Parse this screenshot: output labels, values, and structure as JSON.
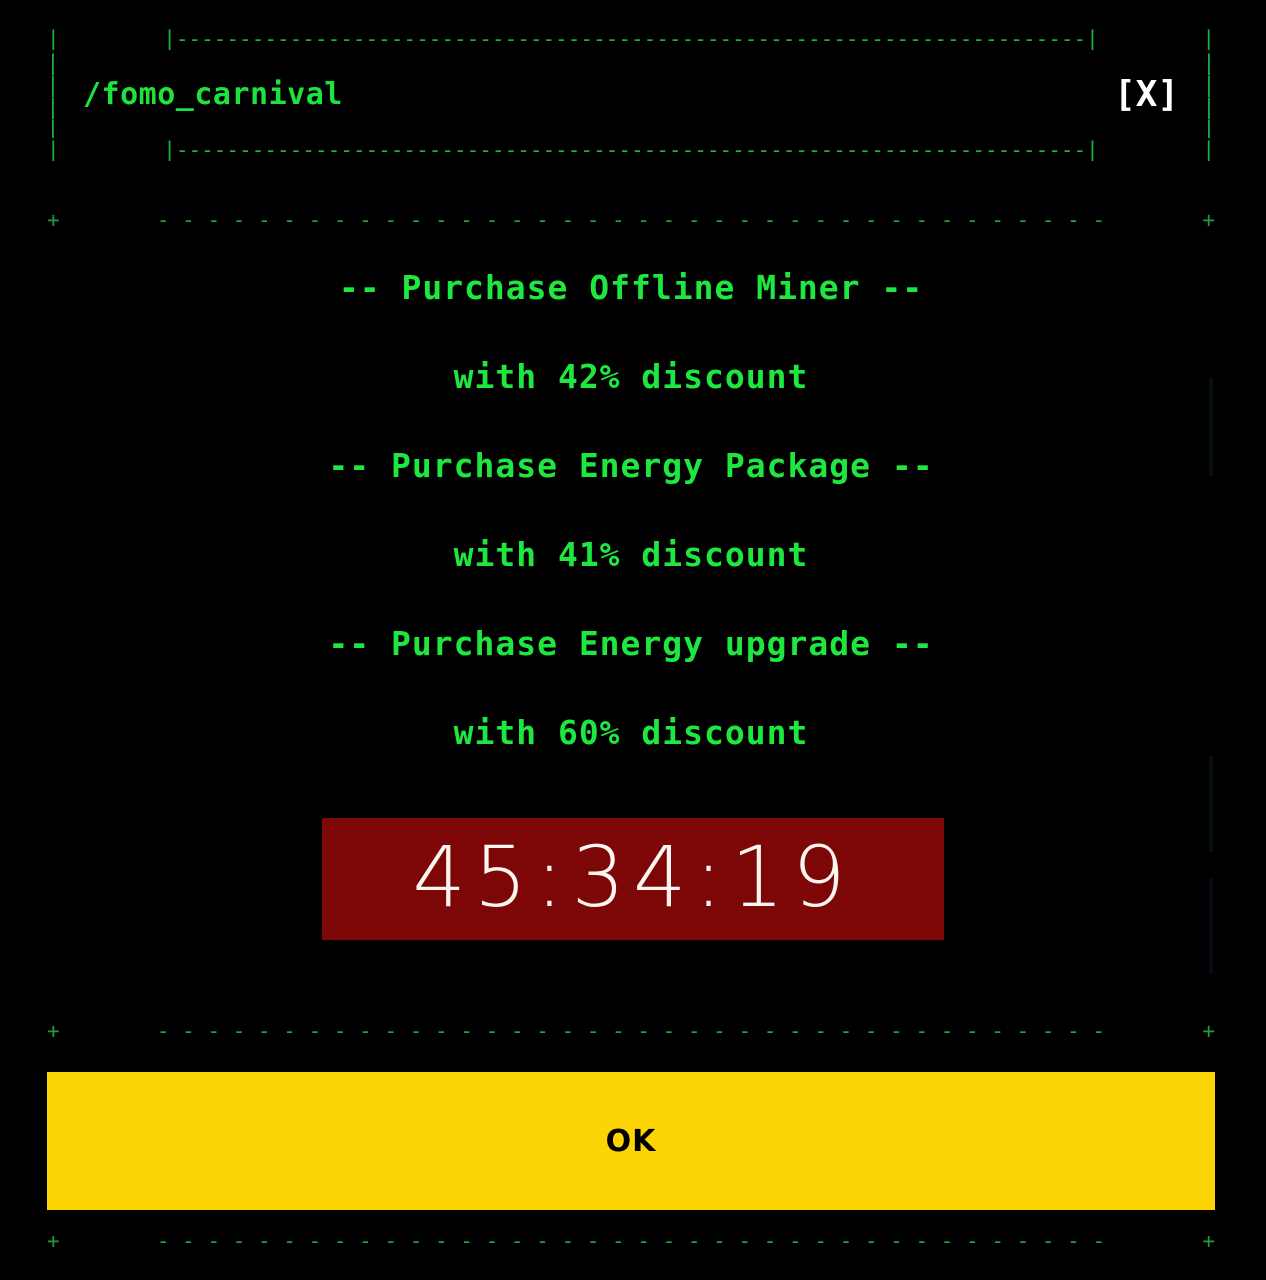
{
  "colors": {
    "background": "#000000",
    "terminal_green": "#1ee83f",
    "border_green": "#1cb23f",
    "timer_bg": "#7d0606",
    "timer_text": "#fdf6f0",
    "button_yellow": "#fcd303",
    "button_text": "#000000",
    "close_white": "#ffffff"
  },
  "dialog": {
    "title": "/fomo_carnival",
    "close_label": "[X]"
  },
  "borders": {
    "title_top": "|------------------------------------------------------------------------|",
    "title_bottom": "|------------------------------------------------------------------------|",
    "title_side": "|",
    "separator_cap": "+",
    "separator_fill": "- - - - - - - - - - - - - - - - - - - - - - - - - - - - - - - - - - - - - -"
  },
  "offers": [
    {
      "title": "-- Purchase Offline Miner --",
      "subtitle": "with 42% discount",
      "discount_percent": 42,
      "item": "Offline Miner"
    },
    {
      "title": "-- Purchase Energy Package --",
      "subtitle": "with 41% discount",
      "discount_percent": 41,
      "item": "Energy Package"
    },
    {
      "title": "-- Purchase Energy upgrade --",
      "subtitle": "with 60% discount",
      "discount_percent": 60,
      "item": "Energy upgrade"
    }
  ],
  "timer": {
    "value": "45:34:19",
    "hours": "45",
    "minutes": "34",
    "seconds": "19"
  },
  "footer": {
    "ok_label": "OK"
  }
}
